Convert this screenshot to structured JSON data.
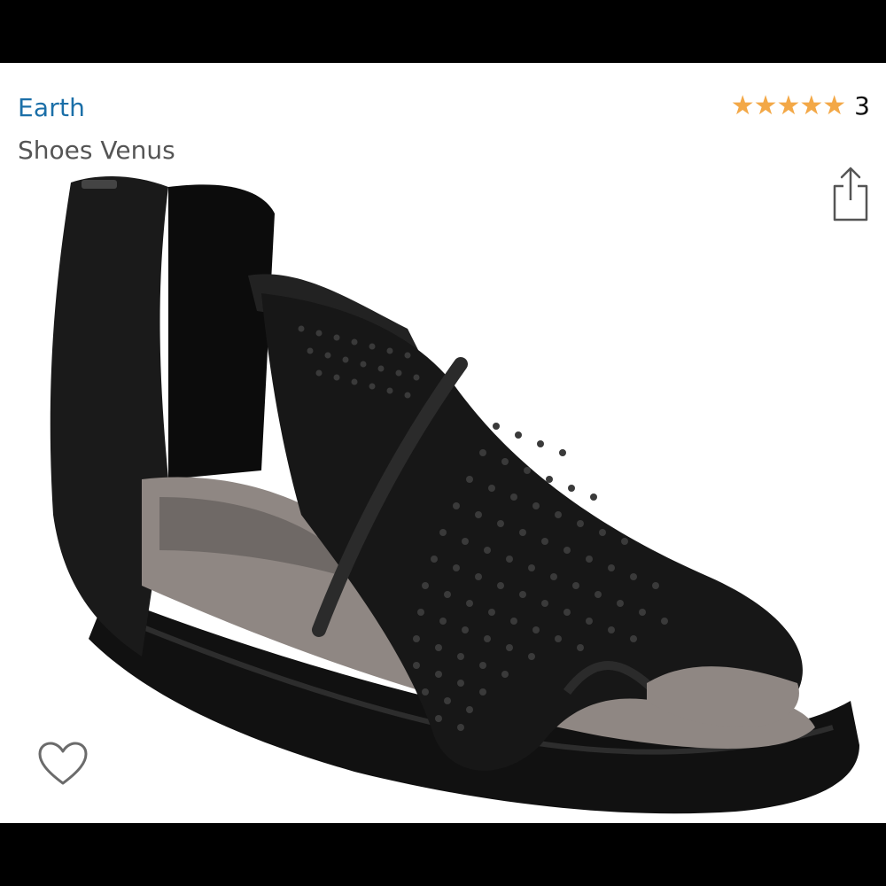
{
  "product": {
    "brand": "Earth",
    "name": "Shoes Venus",
    "rating_stars": "★★★★★",
    "rating_value": 5,
    "review_count": "3"
  },
  "colors": {
    "brand_link": "#1b6fa8",
    "star": "#f3a847",
    "page_bg": "#ffffff",
    "letterbox": "#000000"
  },
  "icons": {
    "share": "share-icon",
    "favorite": "heart-outline-icon",
    "rating": "star-icon"
  }
}
